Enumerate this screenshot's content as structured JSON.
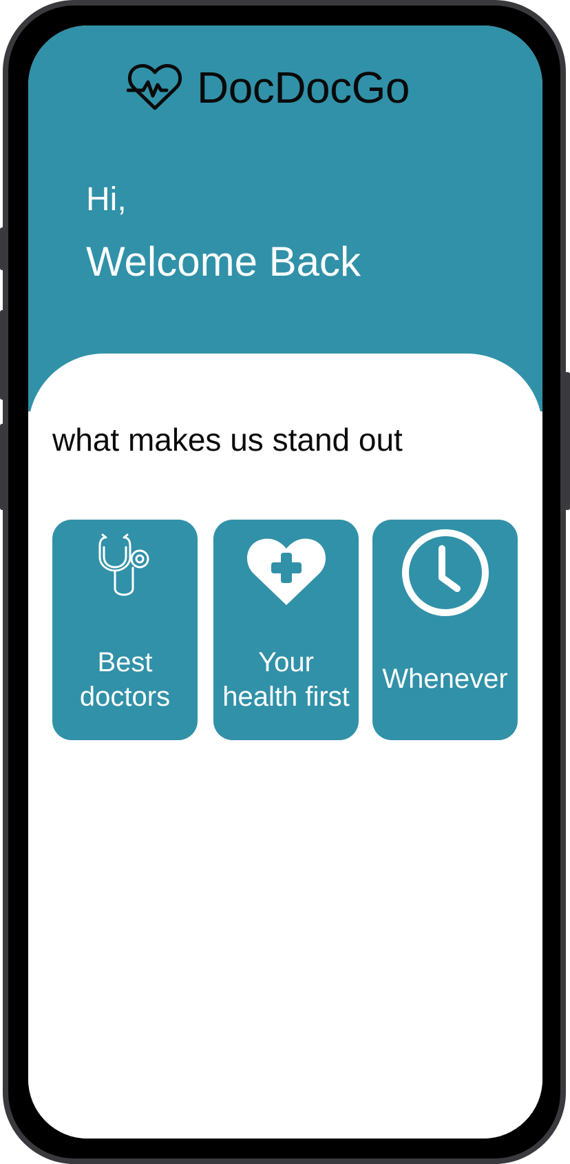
{
  "app": {
    "name": "DocDocGo",
    "logo_icon": "heartbeat-icon"
  },
  "header": {
    "greeting": "Hi,",
    "welcome": "Welcome Back"
  },
  "main": {
    "section_title": "what makes us stand out",
    "features": [
      {
        "icon": "stethoscope-icon",
        "line1": "Best",
        "line2": "doctors"
      },
      {
        "icon": "heart-plus-icon",
        "line1": "Your",
        "line2": "health first"
      },
      {
        "icon": "clock-icon",
        "line1": "Whenever",
        "line2": ""
      }
    ]
  },
  "colors": {
    "primary": "#3191a8",
    "frame": "#3a393e",
    "text_dark": "#0a0a0a",
    "text_light": "#ffffff"
  }
}
